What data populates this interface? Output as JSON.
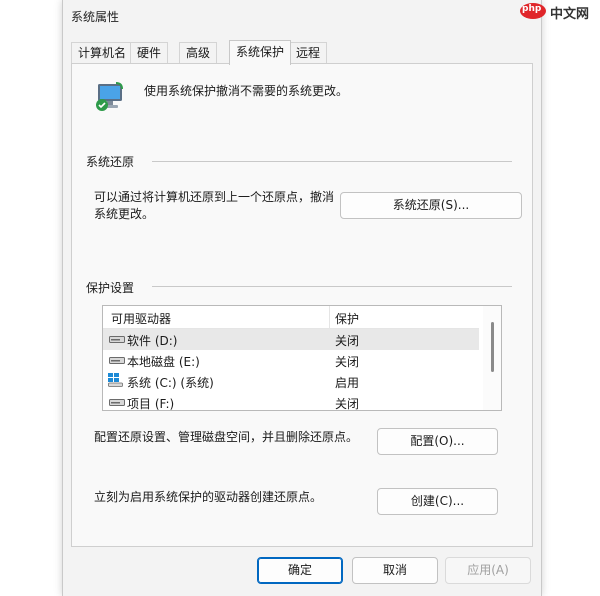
{
  "window": {
    "title": "系统属性"
  },
  "tabs": [
    {
      "label": "计算机名"
    },
    {
      "label": "硬件"
    },
    {
      "label": "高级"
    },
    {
      "label": "系统保护"
    },
    {
      "label": "远程"
    }
  ],
  "active_tab": "系统保护",
  "intro_text": "使用系统保护撤消不需要的系统更改。",
  "restore_section": {
    "title": "系统还原",
    "description_line1": "可以通过将计算机还原到上一个还原点，撤消",
    "description_line2": "系统更改。",
    "button_label": "系统还原(S)..."
  },
  "protection_section": {
    "title": "保护设置",
    "columns": [
      "可用驱动器",
      "保护"
    ],
    "drives": [
      {
        "name": "软件 (D:)",
        "status": "关闭",
        "icon": "drive-icon",
        "selected": true
      },
      {
        "name": "本地磁盘 (E:)",
        "status": "关闭",
        "icon": "drive-icon"
      },
      {
        "name": "系统 (C:) (系统)",
        "status": "启用",
        "icon": "windows-drive-icon"
      },
      {
        "name": "项目 (F:)",
        "status": "关闭",
        "icon": "drive-icon"
      }
    ],
    "configure_text": "配置还原设置、管理磁盘空间，并且删除还原点。",
    "configure_button": "配置(O)...",
    "create_text": "立刻为启用系统保护的驱动器创建还原点。",
    "create_button": "创建(C)..."
  },
  "footer": {
    "ok": "确定",
    "cancel": "取消",
    "apply": "应用(A)"
  },
  "watermark": {
    "text": "中文网",
    "logo_text": "php"
  },
  "colors": {
    "accent": "#0067c0",
    "watermark_red": "#e0262a"
  }
}
